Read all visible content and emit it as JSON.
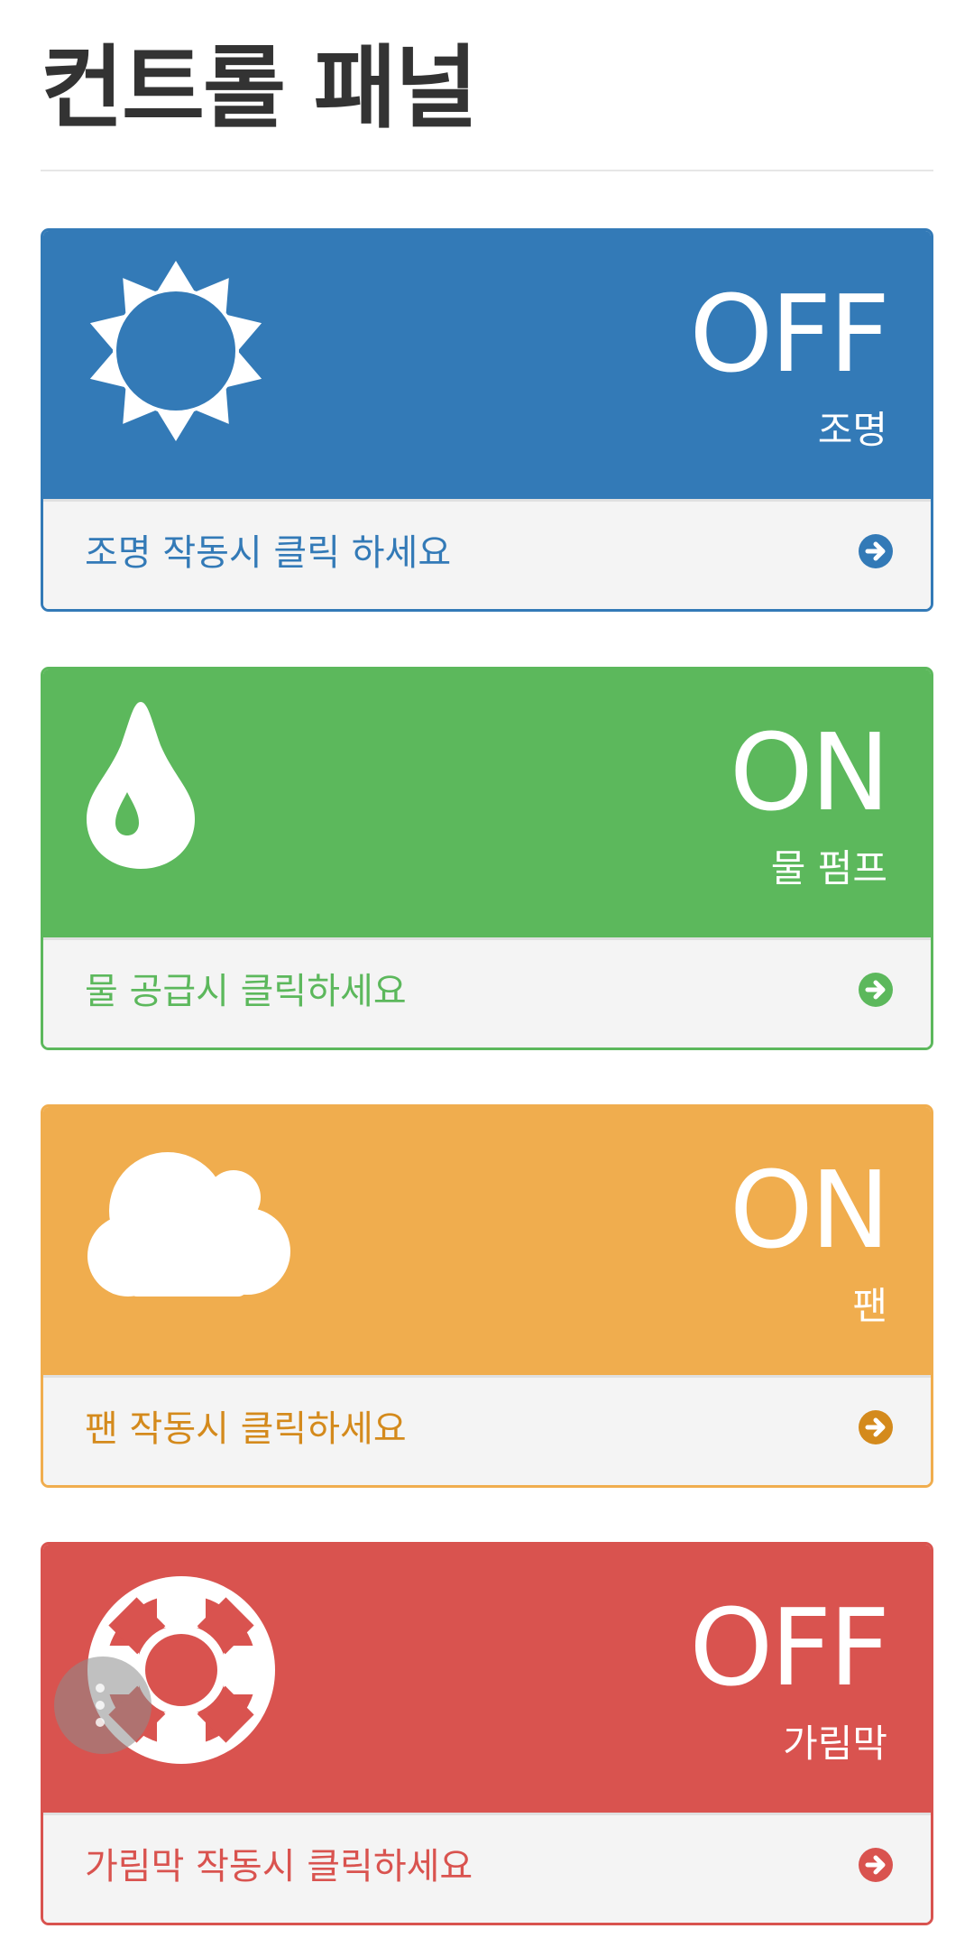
{
  "title": "컨트롤 패널",
  "colors": {
    "blue": "#337ab7",
    "green": "#5cb85c",
    "orange": "#f0ad4e",
    "red": "#d9534f",
    "footer_bg": "#f4f4f4"
  },
  "panels": [
    {
      "status": "OFF",
      "label": "조명",
      "footer_text": "조명 작동시 클릭 하세요",
      "icon": "sun-icon",
      "color": "#337ab7",
      "footer_color": "#337ab7"
    },
    {
      "status": "ON",
      "label": "물 펌프",
      "footer_text": "물 공급시 클릭하세요",
      "icon": "water-drop-icon",
      "color": "#5cb85c",
      "footer_color": "#5cb85c"
    },
    {
      "status": "ON",
      "label": "팬",
      "footer_text": "팬 작동시 클릭하세요",
      "icon": "cloud-icon",
      "color": "#f0ad4e",
      "footer_color": "#d48a1c"
    },
    {
      "status": "OFF",
      "label": "가림막",
      "footer_text": "가림막 작동시 클릭하세요",
      "icon": "lifebuoy-icon",
      "color": "#d9534f",
      "footer_color": "#d9534f"
    }
  ],
  "floating_button_icon": "more-vertical-icon"
}
